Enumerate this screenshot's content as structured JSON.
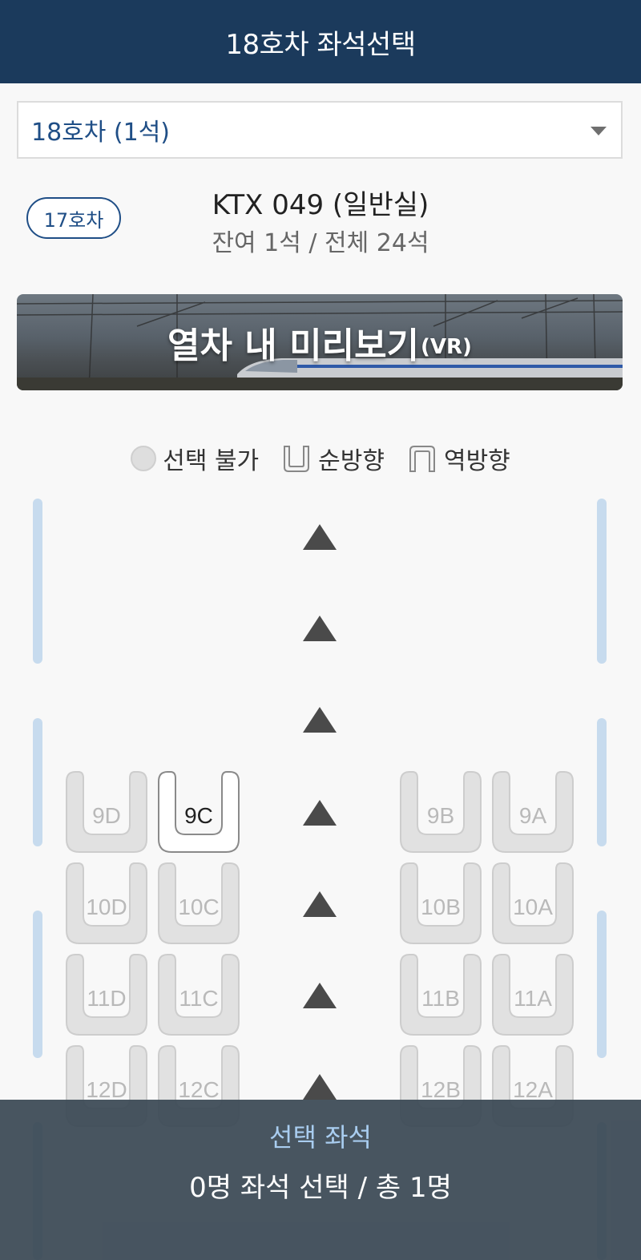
{
  "header": {
    "title": "18호차 좌석선택"
  },
  "car_select": {
    "value": "18호차 (1석)"
  },
  "prev_car": {
    "label": "17호차"
  },
  "train": {
    "name": "KTX 049 (일반실)",
    "seat_count": "잔여 1석 / 전체 24석"
  },
  "vr_banner": {
    "label": "열차 내 미리보기",
    "suffix": "(VR)"
  },
  "legend": {
    "unavailable": "선택 불가",
    "forward": "순방향",
    "reverse": "역방향"
  },
  "seats": [
    {
      "id": "9D",
      "available": false
    },
    {
      "id": "9C",
      "available": true
    },
    {
      "id": "9B",
      "available": false
    },
    {
      "id": "9A",
      "available": false
    },
    {
      "id": "10D",
      "available": false
    },
    {
      "id": "10C",
      "available": false
    },
    {
      "id": "10B",
      "available": false
    },
    {
      "id": "10A",
      "available": false
    },
    {
      "id": "11D",
      "available": false
    },
    {
      "id": "11C",
      "available": false
    },
    {
      "id": "11B",
      "available": false
    },
    {
      "id": "11A",
      "available": false
    },
    {
      "id": "12D",
      "available": false
    },
    {
      "id": "12C",
      "available": false
    },
    {
      "id": "12B",
      "available": false
    },
    {
      "id": "12A",
      "available": false
    }
  ],
  "bottom": {
    "title": "선택 좌석",
    "status": "0명 좌석 선택 / 총 1명"
  },
  "colors": {
    "header": "#1b3a5c",
    "accent": "#1f4e86",
    "window": "#c7dbee",
    "panel": "#3a4854"
  }
}
